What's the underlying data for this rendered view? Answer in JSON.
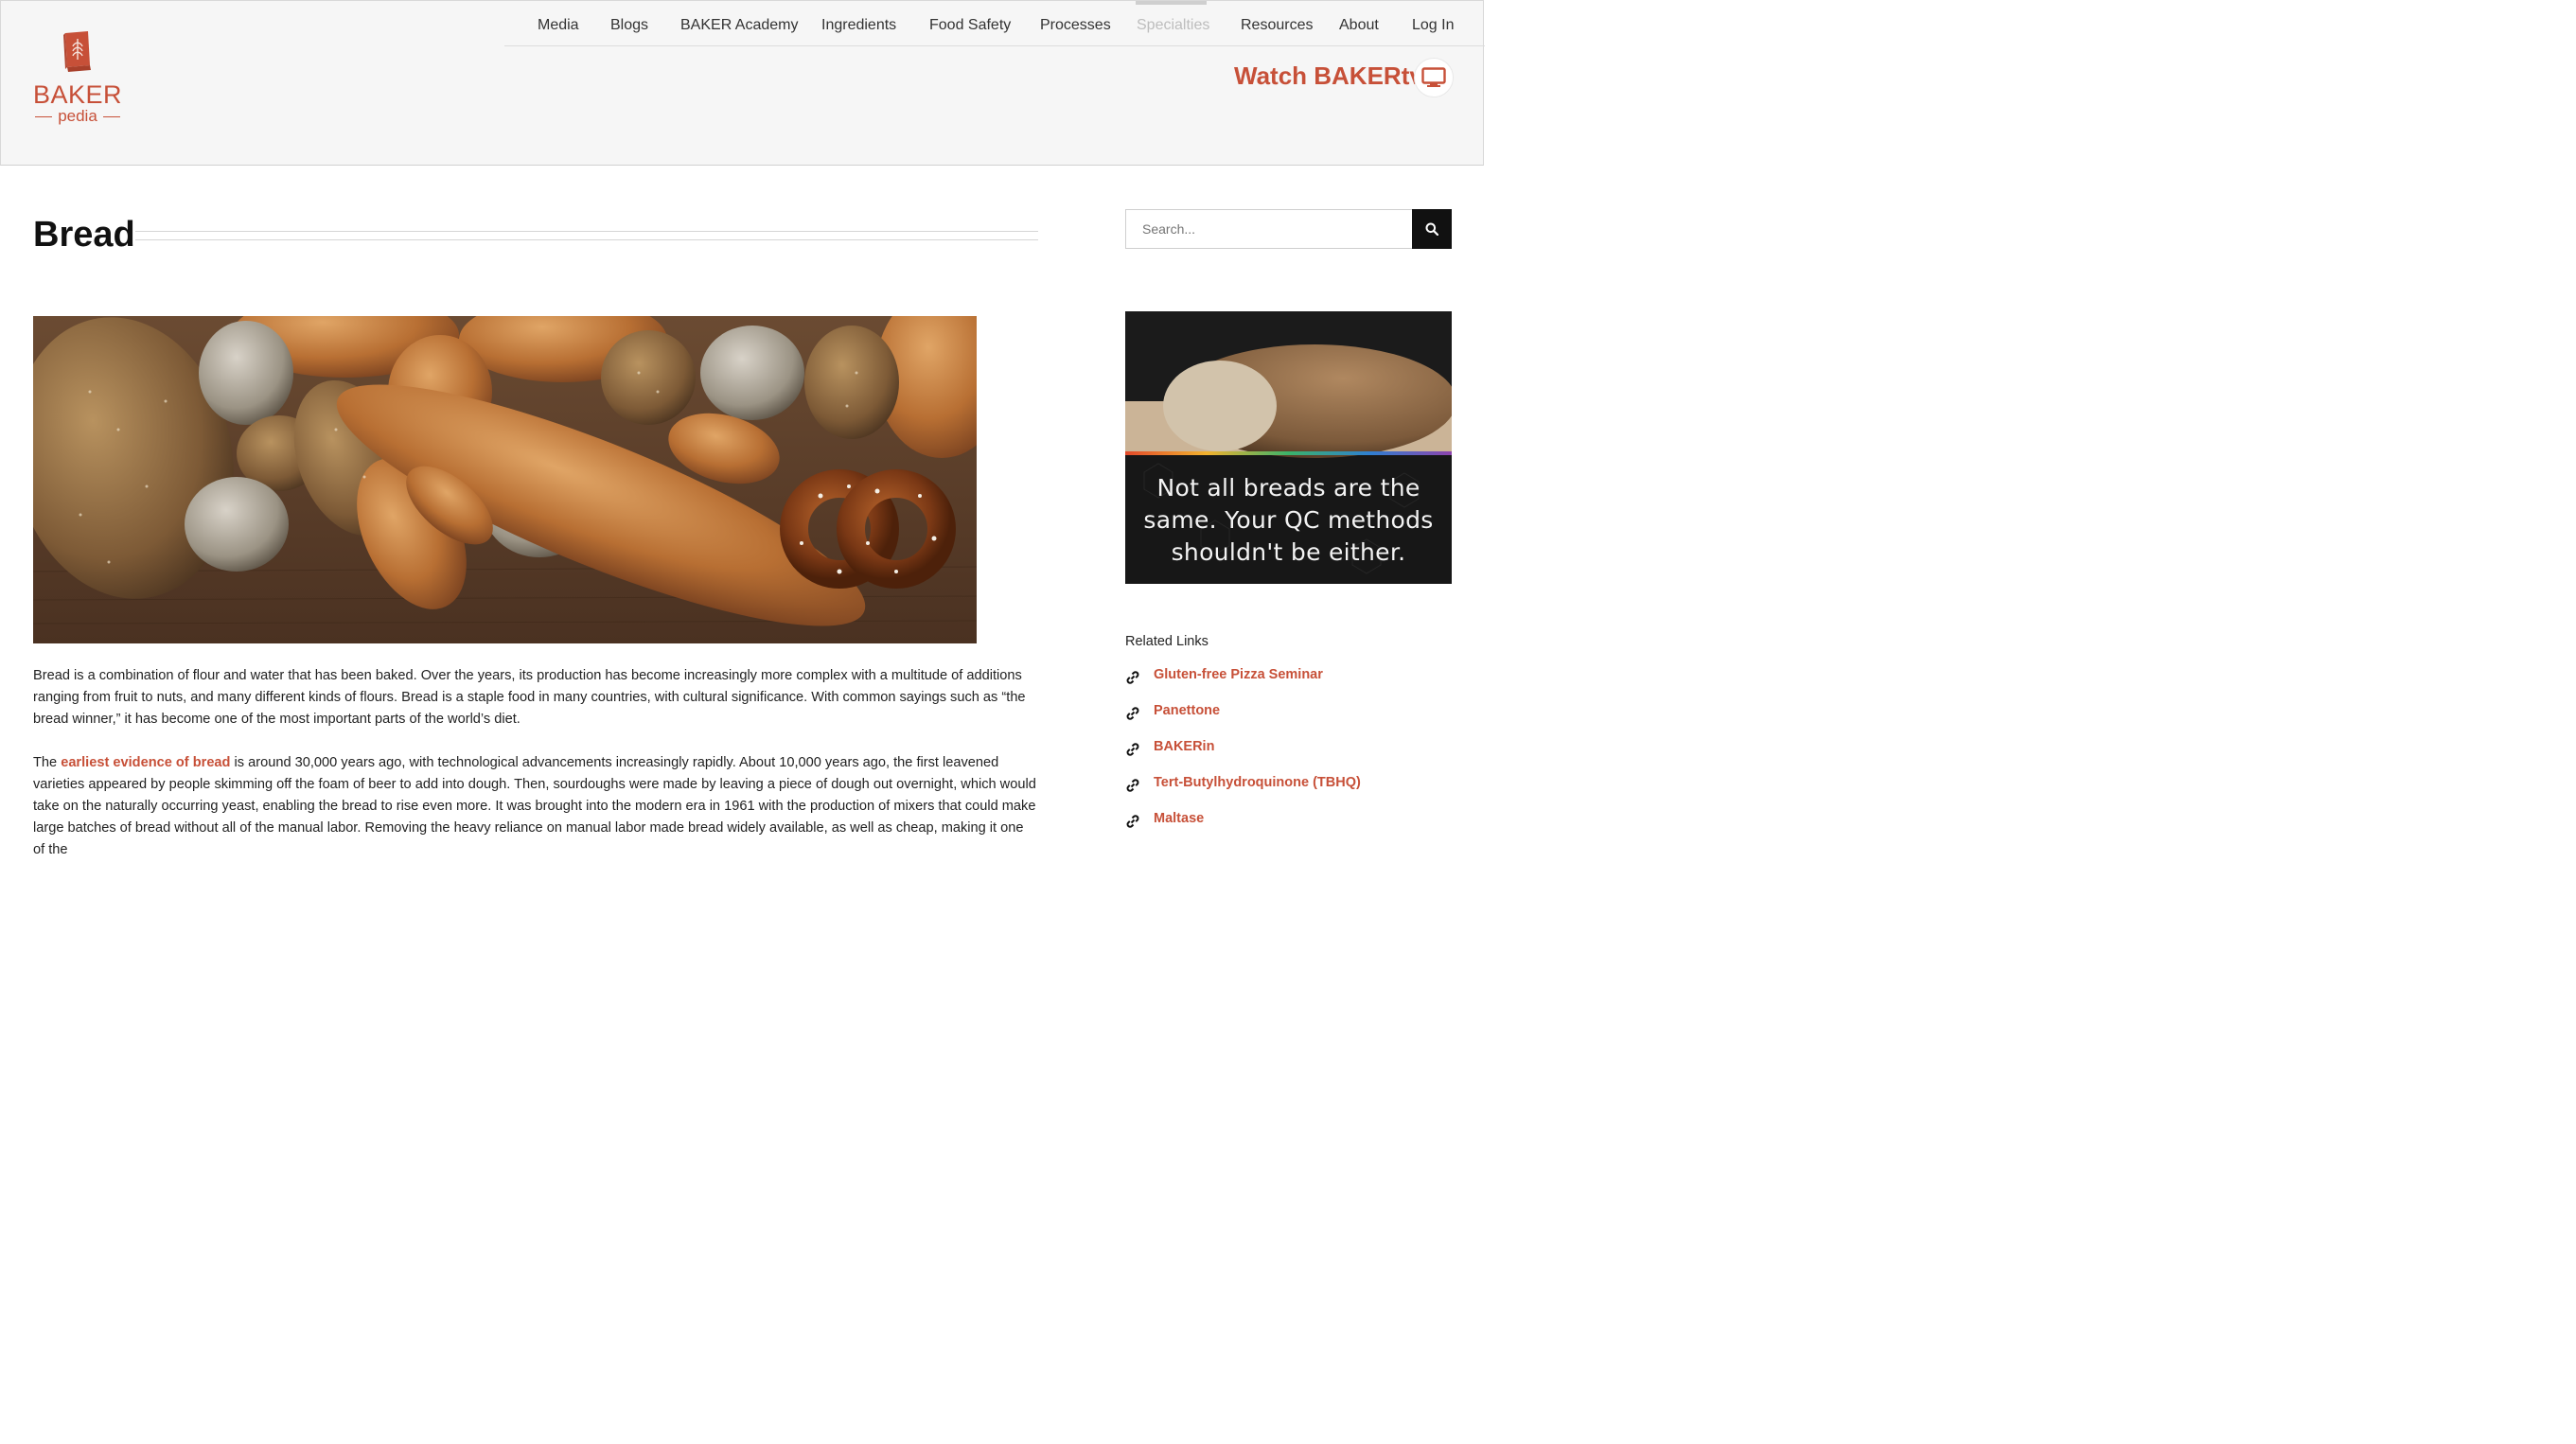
{
  "brand": {
    "logo_line1": "BAKER",
    "logo_line2": "pedia",
    "accent": "#c75038"
  },
  "nav": {
    "items": [
      {
        "label": "Media",
        "active": false
      },
      {
        "label": "Blogs",
        "active": false
      },
      {
        "label": "BAKER Academy",
        "active": false
      },
      {
        "label": "Ingredients",
        "active": false
      },
      {
        "label": "Food Safety",
        "active": false
      },
      {
        "label": "Processes",
        "active": false
      },
      {
        "label": "Specialties",
        "active": true
      },
      {
        "label": "Resources",
        "active": false
      },
      {
        "label": "About",
        "active": false
      },
      {
        "label": "Log In",
        "active": false
      }
    ]
  },
  "watch": {
    "label": "Watch BAKERtv",
    "icon": "monitor-icon"
  },
  "page": {
    "title": "Bread",
    "hero_alt": "Assorted breads, rolls, croissants and pretzel on wooden table"
  },
  "content": {
    "p1": "Bread is a combination of flour and water that has been baked. Over the years, its production has become increasingly more complex with a multitude of additions ranging from fruit to nuts, and many different kinds of flours. Bread is a staple food in many countries, with cultural significance. With common sayings such as “the bread winner,” it has become one of the most important parts of the world’s diet.",
    "p2_prefix": "The ",
    "p2_link": "earliest evidence of bread",
    "p2_rest": " is around 30,000 years ago, with technological advancements increasingly rapidly. About 10,000 years ago, the first leavened varieties appeared by people skimming off the foam of beer to add into dough. Then, sourdoughs were made by leaving a piece of dough out overnight, which would take on the naturally occurring yeast, enabling the bread to rise even more. It was brought into the modern era in 1961 with the production of mixers that could make large batches of bread without all of the manual labor. Removing the heavy reliance on manual labor made bread widely available, as well as cheap, making it one of the"
  },
  "sidebar": {
    "search_placeholder": "Search...",
    "ad_text_lines": [
      "Not all breads are the",
      "same. Your QC methods",
      "shouldn't be either."
    ],
    "related_title": "Related Links",
    "related_links": [
      "Gluten-free Pizza Seminar",
      "Panettone",
      "BAKERin",
      "Tert-Butylhydroquinone (TBHQ)",
      "Maltase"
    ]
  }
}
